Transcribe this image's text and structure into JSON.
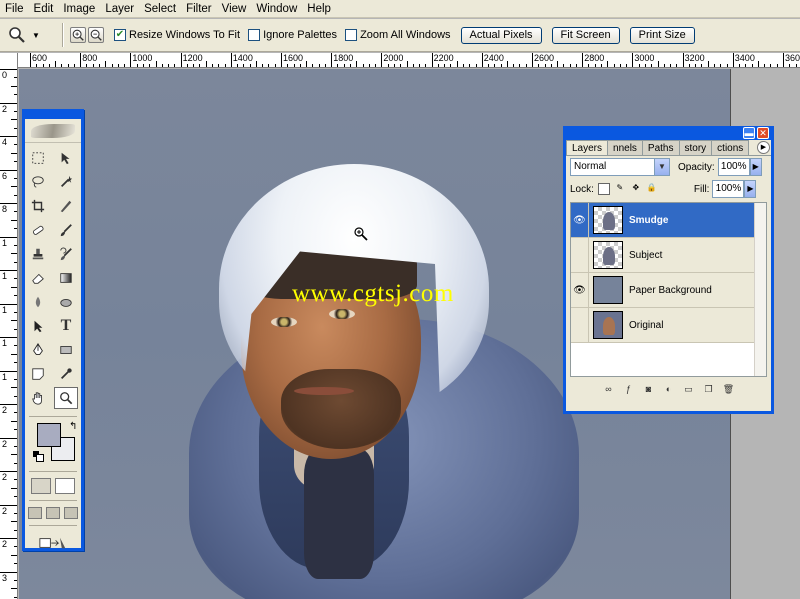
{
  "menu": [
    "File",
    "Edit",
    "Image",
    "Layer",
    "Select",
    "Filter",
    "View",
    "Window",
    "Help"
  ],
  "options": {
    "resize_windows": "Resize Windows To Fit",
    "ignore_palettes": "Ignore Palettes",
    "zoom_all": "Zoom All Windows",
    "actual_pixels": "Actual Pixels",
    "fit_screen": "Fit Screen",
    "print_size": "Print Size",
    "resize_checked": true,
    "ignore_checked": false,
    "zoom_all_checked": false
  },
  "ruler": {
    "top_labels": [
      "600",
      "800",
      "1000",
      "1200",
      "1400",
      "1600",
      "1800",
      "2000",
      "2200",
      "2400",
      "2600",
      "2800",
      "3000",
      "3200",
      "3400",
      "3600"
    ],
    "left_labels": [
      "0",
      "2",
      "4",
      "6",
      "8",
      "1",
      "1",
      "1",
      "1",
      "1",
      "2",
      "2",
      "2",
      "2",
      "2",
      "3"
    ]
  },
  "watermark": "www.cgtsj.com",
  "layers_panel": {
    "tabs": [
      "Layers",
      "nnels",
      "Paths",
      "story",
      "ctions"
    ],
    "blend_mode": "Normal",
    "opacity_label": "Opacity:",
    "opacity_value": "100%",
    "lock_label": "Lock:",
    "fill_label": "Fill:",
    "fill_value": "100%",
    "layers": [
      {
        "name": "Smudge",
        "visible": true,
        "selected": true
      },
      {
        "name": "Subject",
        "visible": false,
        "selected": false
      },
      {
        "name": "Paper Background",
        "visible": true,
        "selected": false
      },
      {
        "name": "Original",
        "visible": false,
        "selected": false
      }
    ]
  },
  "colors": {
    "foreground": "#a8acc0",
    "background": "#ecedf0",
    "xp_blue": "#0a58e0",
    "selection": "#316ac5",
    "canvas": "#76839a"
  }
}
